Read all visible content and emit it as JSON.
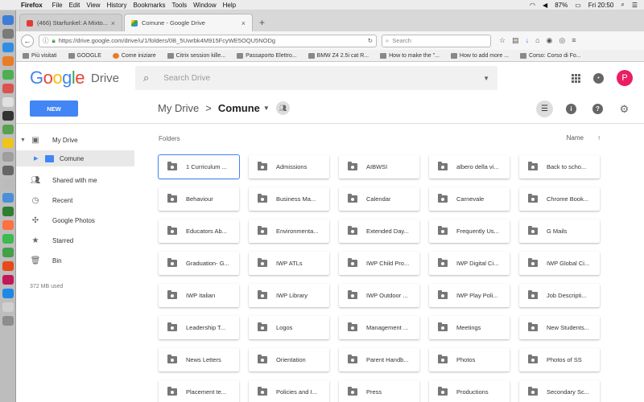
{
  "menubar": {
    "app": "Firefox",
    "items": [
      "File",
      "Edit",
      "View",
      "History",
      "Bookmarks",
      "Tools",
      "Window",
      "Help"
    ],
    "battery": "87%",
    "clock": "Fri 20:50"
  },
  "tabs": [
    {
      "title": "(466) Starfunkel: A Mixto...",
      "favicon_color": "#e53935"
    },
    {
      "title": "Comune - Google Drive",
      "favicon_color": "#34a853"
    }
  ],
  "addressbar": {
    "url": "https://drive.google.com/drive/u/1/folders/0B_5Uwrbk4M915FcyWE5OQU5NODg",
    "search_placeholder": "Search"
  },
  "bookmarks": [
    "Più visitati",
    "GOOGLE",
    "Come iniziare",
    "Citrix session kille...",
    "Passaporto Elettro...",
    "BMW Z4 2.5i cat R...",
    "How to make the \"...",
    "How to add more ...",
    "Corso: Corso di Fo..."
  ],
  "drive": {
    "logo_letters": [
      "G",
      "o",
      "o",
      "g",
      "l",
      "e"
    ],
    "product": "Drive",
    "search_placeholder": "Search Drive",
    "avatar_letter": "P",
    "new_button": "NEW",
    "breadcrumb": {
      "root": "My Drive",
      "separator": ">",
      "current": "Comune"
    }
  },
  "sidebar": {
    "items": [
      {
        "label": "My Drive",
        "icon": "drive-icon"
      },
      {
        "label": "Comune",
        "icon": "shared-folder-icon"
      },
      {
        "label": "Shared with me",
        "icon": "people-icon"
      },
      {
        "label": "Recent",
        "icon": "clock-icon"
      },
      {
        "label": "Google Photos",
        "icon": "pinwheel-icon"
      },
      {
        "label": "Starred",
        "icon": "star-icon"
      },
      {
        "label": "Bin",
        "icon": "trash-icon"
      }
    ],
    "storage": "372 MB used"
  },
  "main": {
    "section_label": "Folders",
    "sort_label": "Name",
    "sort_arrow": "↑",
    "folders": [
      "1 Curriculum ...",
      "Admissions",
      "AIBWSI",
      "albero della vi...",
      "Back to scho...",
      "Behaviour",
      "Business Ma...",
      "Calendar",
      "Carnevale",
      "Chrome Book...",
      "Educators Ab...",
      "Environmenta...",
      "Extended Day...",
      "Frequently Us...",
      "G Mails",
      "Graduation- G...",
      "IWP ATLs",
      "IWP Child Pro...",
      "IWP Digital Ci...",
      "IWP Global Ci...",
      "IWP Italian",
      "IWP Library",
      "IWP Outdoor ...",
      "IWP Play Poli...",
      "Job Descripti...",
      "Leadership T...",
      "Logos",
      "Management ...",
      "Meetings",
      "New Students...",
      "News Letters",
      "Orientation",
      "Parent Handb...",
      "Photos",
      "Photos of SS",
      "Placement te...",
      "Policies and I...",
      "Press",
      "Productions",
      "Secondary Sc..."
    ],
    "selected_index": 0
  }
}
